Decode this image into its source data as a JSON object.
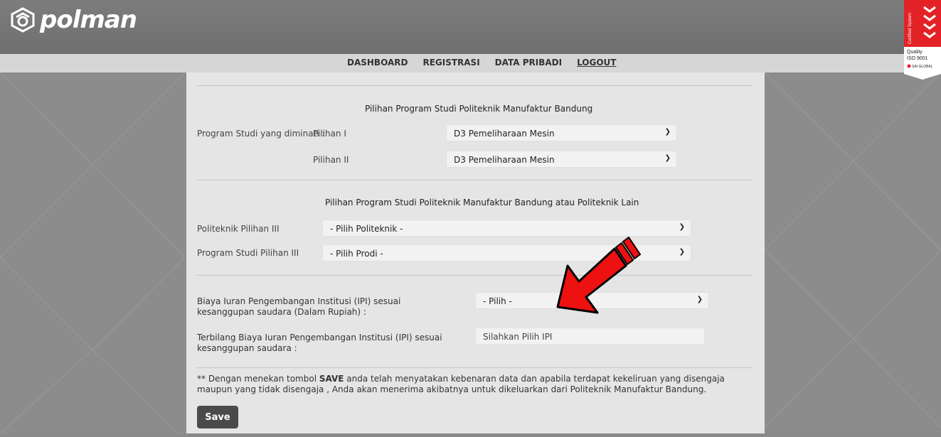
{
  "header": {
    "logo_text": "polman",
    "cert_badge": {
      "lines": [
        "Certified System",
        "Quality",
        "ISO 9001",
        "SAI GLOBAL"
      ],
      "accent_color": "#e32227"
    }
  },
  "nav": {
    "items": [
      "DASHBOARD",
      "REGISTRASI",
      "DATA PRIBADI",
      "LOGOUT"
    ]
  },
  "section1": {
    "title": "Pilihan Program Studi Politeknik Manufaktur Bandung",
    "label_main": "Program Studi yang diminati :",
    "label_p1": "Pilihan I",
    "value_p1": "D3 Pemeliharaan Mesin",
    "label_p2": "Pilihan II",
    "value_p2": "D3 Pemeliharaan Mesin"
  },
  "section2": {
    "title": "Pilihan Program Studi Politeknik Manufaktur Bandung atau Politeknik Lain",
    "label_poli": "Politeknik Pilihan III",
    "value_poli": "- Pilih Politeknik -",
    "label_prodi": "Program Studi Pilihan III",
    "value_prodi": "- Pilih Prodi -"
  },
  "section3": {
    "label_ipi": "Biaya Iuran Pengembangan Institusi (IPI) sesuai kesanggupan saudara (Dalam Rupiah) :",
    "value_ipi": "- Pilih -",
    "label_terbilang": "Terbilang Biaya Iuran Pengembangan Institusi (IPI) sesuai kesanggupan saudara :",
    "placeholder_terbilang": "Silahkan Pilih IPI"
  },
  "note": {
    "prefix": "** Dengan menekan tombol ",
    "bold": "SAVE",
    "suffix": " anda telah menyatakan kebenaran data dan apabila terdapat kekeliruan yang disengaja maupun yang tidak disengaja , Anda akan menerima akibatnya untuk dikeluarkan dari Politeknik Manufaktur Bandung."
  },
  "save_label": "Save",
  "colors": {
    "arrow": "#ee1111",
    "button": "#4a4a4a"
  }
}
